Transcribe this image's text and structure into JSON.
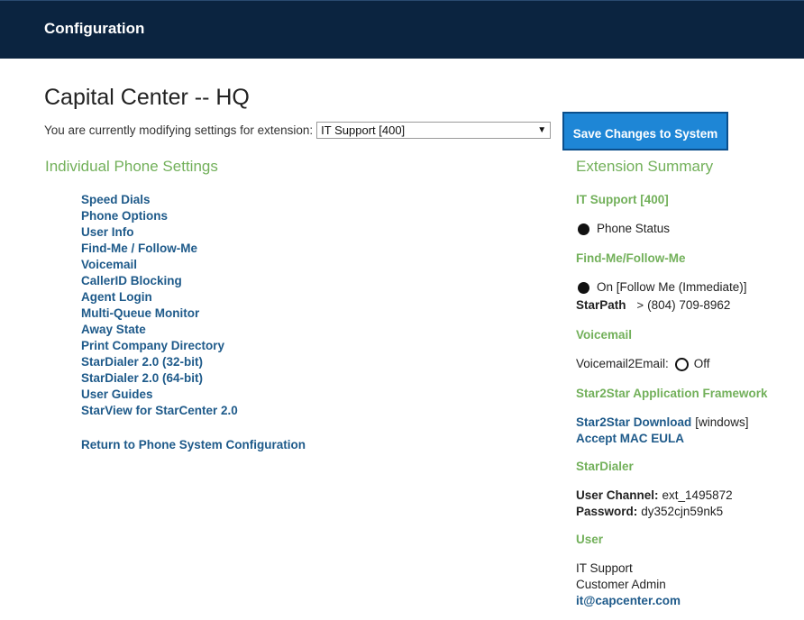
{
  "header": {
    "title": "Configuration"
  },
  "page": {
    "title": "Capital Center -- HQ",
    "extension_prompt": "You are currently modifying settings for extension:",
    "extension_selected": "IT Support [400]",
    "save_button": "Save Changes to System"
  },
  "left": {
    "heading": "Individual Phone Settings",
    "links": [
      "Speed Dials",
      "Phone Options",
      "User Info",
      "Find-Me / Follow-Me",
      "Voicemail",
      "CallerID Blocking",
      "Agent Login",
      "Multi-Queue Monitor",
      "Away State",
      "Print Company Directory",
      "StarDialer 2.0 (32-bit)",
      "StarDialer 2.0 (64-bit)",
      "User Guides",
      "StarView for StarCenter 2.0"
    ],
    "return_link": "Return to Phone System Configuration"
  },
  "summary": {
    "heading": "Extension Summary",
    "extension_name": "IT Support [400]",
    "phone_status_label": "Phone Status",
    "findme_heading": "Find-Me/Follow-Me",
    "findme_status": "On [Follow Me (Immediate)]",
    "starpath_label": "StarPath",
    "starpath_number": "(804) 709-8962",
    "voicemail_heading": "Voicemail",
    "voicemail2email_label": "Voicemail2Email:",
    "voicemail2email_value": "Off",
    "framework_heading": "Star2Star Application Framework",
    "download_link": "Star2Star Download",
    "download_platform": "[windows]",
    "eula_link": "Accept MAC EULA",
    "stardialer_heading": "StarDialer",
    "user_channel_label": "User Channel:",
    "user_channel_value": "ext_1495872",
    "password_label": "Password:",
    "password_value": "dy352cjn59nk5",
    "user_heading": "User",
    "user_name": "IT Support",
    "user_role": "Customer Admin",
    "user_email": "it@capcenter.com"
  },
  "colors": {
    "header_bg": "#0b2440",
    "accent_green": "#72b05a",
    "link_blue": "#1e5a8a",
    "button_blue": "#1e86d6"
  }
}
